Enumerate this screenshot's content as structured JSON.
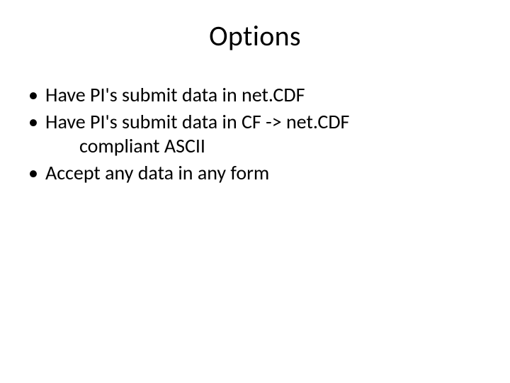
{
  "slide": {
    "title": "Options",
    "bullets": [
      {
        "line1": "Have PI's submit data in net.CDF"
      },
      {
        "line1": "Have PI's submit data in CF -> net.CDF",
        "line2": "compliant ASCII"
      },
      {
        "line1": "Accept any data in any form"
      }
    ]
  }
}
